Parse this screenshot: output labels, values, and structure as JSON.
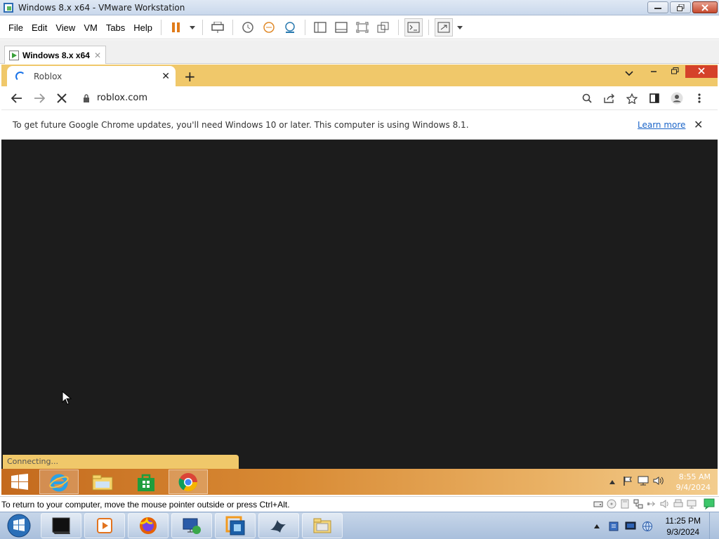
{
  "vmware": {
    "title": "Windows 8.x x64 - VMware Workstation",
    "menu": [
      "File",
      "Edit",
      "View",
      "VM",
      "Tabs",
      "Help"
    ],
    "tab_label": "Windows 8.x x64",
    "tab_close": "✕",
    "status_hint": "To return to your computer, move the mouse pointer outside or press Ctrl+Alt."
  },
  "chrome": {
    "tab_title": "Roblox",
    "tab_close": "✕",
    "new_tab": "+",
    "url": "roblox.com",
    "infobar_message": "To get future Google Chrome updates, you'll need Windows 10 or later. This computer is using Windows 8.1.",
    "infobar_link": "Learn more",
    "infobar_close": "✕",
    "status": "Connecting...",
    "frame_color": "#f0c86a",
    "page_color": "#1c1c1c"
  },
  "guest_taskbar": {
    "time": "8:55 AM",
    "date": "9/4/2024",
    "apps": [
      "start-icon",
      "internet-explorer-icon",
      "file-explorer-icon",
      "store-icon",
      "chrome-icon"
    ]
  },
  "host_taskbar": {
    "time": "11:25 PM",
    "date": "9/3/2024",
    "apps": [
      "windows-start-orb-icon",
      "terminal-icon",
      "media-player-icon",
      "firefox-icon",
      "remote-desktop-icon",
      "vmware-icon",
      "bird-app-icon",
      "folder-icon"
    ]
  }
}
